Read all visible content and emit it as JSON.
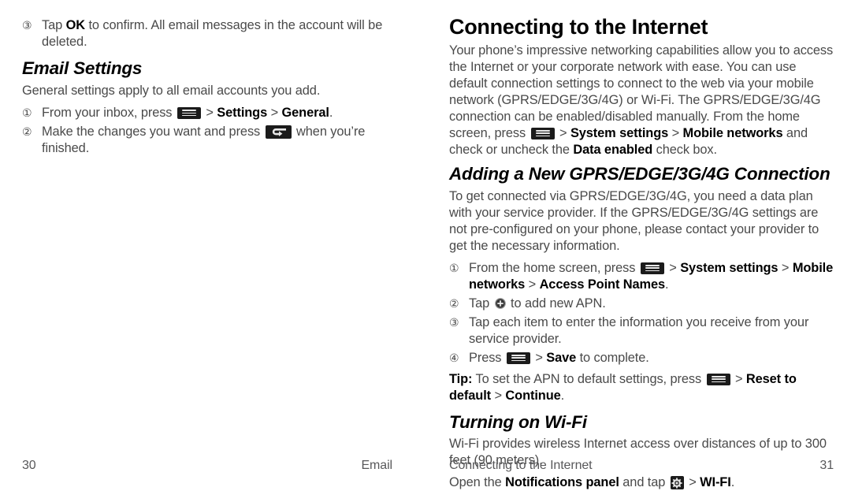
{
  "document": {
    "type": "phone-user-manual-spread"
  },
  "left_page": {
    "continued_step": {
      "marker": "③",
      "parts": [
        {
          "t": "Tap ",
          "s": "n"
        },
        {
          "t": "OK",
          "s": "b"
        },
        {
          "t": " to confirm. All email messages in the account will be deleted.",
          "s": "n"
        }
      ]
    },
    "heading": "Email Settings",
    "intro": "General settings apply to all email accounts you add.",
    "steps": [
      {
        "marker": "①",
        "parts": [
          {
            "t": "From your inbox, press ",
            "s": "n"
          },
          {
            "t": "",
            "s": "icon-menu"
          },
          {
            "t": " > ",
            "s": "gt"
          },
          {
            "t": "Settings",
            "s": "b"
          },
          {
            "t": " > ",
            "s": "gt"
          },
          {
            "t": "General",
            "s": "b"
          },
          {
            "t": ".",
            "s": "n"
          }
        ]
      },
      {
        "marker": "②",
        "parts": [
          {
            "t": "Make the changes you want and press ",
            "s": "n"
          },
          {
            "t": "",
            "s": "icon-back"
          },
          {
            "t": " when you’re finished.",
            "s": "n"
          }
        ]
      }
    ],
    "footer": {
      "page_number": "30",
      "chapter": "Email"
    }
  },
  "right_page": {
    "heading": "Connecting to the Internet",
    "intro_parts": [
      {
        "t": "Your phone’s impressive networking capabilities allow you to access the Internet or your corporate network with ease. You can use default connection settings to connect to the web via your mobile network (GPRS/EDGE/3G/4G) or Wi-Fi. The GPRS/EDGE/3G/4G connection can be enabled/disabled manually. From the home screen, press ",
        "s": "n"
      },
      {
        "t": "",
        "s": "icon-menu"
      },
      {
        "t": " > ",
        "s": "gt"
      },
      {
        "t": "System settings",
        "s": "b"
      },
      {
        "t": " > ",
        "s": "gt"
      },
      {
        "t": "Mobile networks",
        "s": "b"
      },
      {
        "t": " and check or uncheck the ",
        "s": "n"
      },
      {
        "t": "Data enabled",
        "s": "b"
      },
      {
        "t": " check box.",
        "s": "n"
      }
    ],
    "subsection_apn": {
      "heading": "Adding a New GPRS/EDGE/3G/4G Connection",
      "body": "To get connected via GPRS/EDGE/3G/4G, you need a data plan with your service provider. If the GPRS/EDGE/3G/4G settings are not pre-configured on your phone, please contact your provider to get the necessary information.",
      "steps": [
        {
          "marker": "①",
          "parts": [
            {
              "t": "From the home screen, press ",
              "s": "n"
            },
            {
              "t": "",
              "s": "icon-menu"
            },
            {
              "t": " > ",
              "s": "gt"
            },
            {
              "t": "System settings",
              "s": "b"
            },
            {
              "t": " > ",
              "s": "gt"
            },
            {
              "t": "Mobile networks",
              "s": "b"
            },
            {
              "t": " > ",
              "s": "gt"
            },
            {
              "t": "Access Point Names",
              "s": "b"
            },
            {
              "t": ".",
              "s": "n"
            }
          ]
        },
        {
          "marker": "②",
          "parts": [
            {
              "t": "Tap ",
              "s": "n"
            },
            {
              "t": "",
              "s": "icon-plus"
            },
            {
              "t": " to add new APN.",
              "s": "n"
            }
          ]
        },
        {
          "marker": "③",
          "parts": [
            {
              "t": "Tap each item to enter the information you receive from your service provider.",
              "s": "n"
            }
          ]
        },
        {
          "marker": "④",
          "parts": [
            {
              "t": "Press ",
              "s": "n"
            },
            {
              "t": "",
              "s": "icon-menu"
            },
            {
              "t": " > ",
              "s": "gt"
            },
            {
              "t": "Save",
              "s": "b"
            },
            {
              "t": " to complete.",
              "s": "n"
            }
          ]
        }
      ],
      "tip_parts": [
        {
          "t": "Tip:",
          "s": "b"
        },
        {
          "t": " To set the APN to default settings, press ",
          "s": "n"
        },
        {
          "t": "",
          "s": "icon-menu"
        },
        {
          "t": " > ",
          "s": "gt"
        },
        {
          "t": "Reset to default",
          "s": "b"
        },
        {
          "t": " > ",
          "s": "gt"
        },
        {
          "t": "Continue",
          "s": "b"
        },
        {
          "t": ".",
          "s": "n"
        }
      ]
    },
    "subsection_wifi": {
      "heading": "Turning on Wi-Fi",
      "body": "Wi-Fi provides wireless Internet access over distances of up to 300 feet (90 meters).",
      "open_parts": [
        {
          "t": "Open the ",
          "s": "n"
        },
        {
          "t": "Notifications panel",
          "s": "b"
        },
        {
          "t": " and tap ",
          "s": "n"
        },
        {
          "t": "",
          "s": "icon-gear"
        },
        {
          "t": " > ",
          "s": "gt"
        },
        {
          "t": "WI-FI",
          "s": "b"
        },
        {
          "t": ".",
          "s": "n"
        }
      ]
    },
    "footer": {
      "chapter": "Connecting to the Internet",
      "page_number": "31"
    }
  },
  "icons": {
    "menu_key": "menu-key-icon",
    "back_key": "back-key-icon",
    "gear_key": "gear-key-icon",
    "plus": "plus-circle-icon"
  },
  "colors": {
    "body_text": "#4a4a4a",
    "bold_text": "#000000",
    "key_background": "#1b1b1b",
    "key_glyph": "#e8e8e8",
    "footer_text": "#58585a",
    "page_background": "#ffffff"
  }
}
